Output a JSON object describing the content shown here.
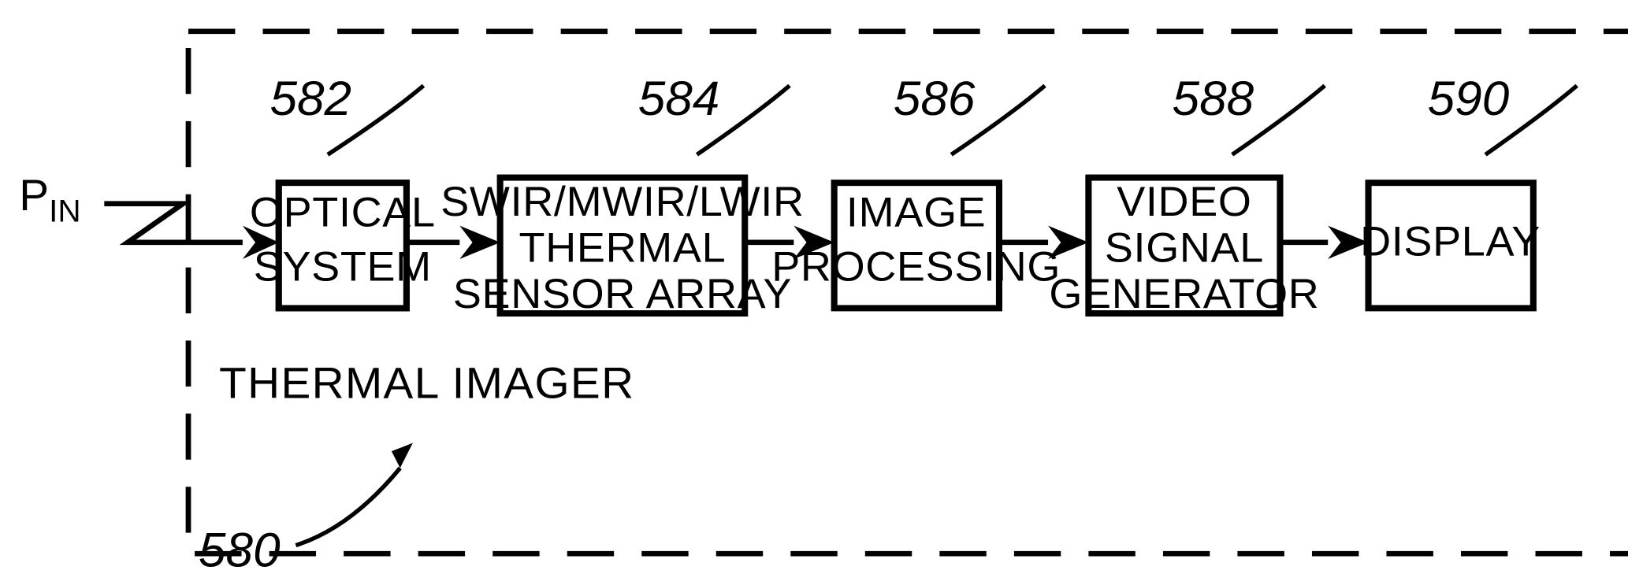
{
  "figure": {
    "title": "THERMAL IMAGER block diagram",
    "stroke_color": "#000000",
    "background_color": "#ffffff"
  },
  "input_signal": {
    "label_main": "P",
    "label_sub": "IN",
    "icon": "zigzag-arrow-icon"
  },
  "enclosure": {
    "label": "THERMAL  IMAGER",
    "reference": "580",
    "style": "dashed"
  },
  "blocks": [
    {
      "id": "optical-system",
      "reference": "582",
      "lines": [
        "OPTICAL",
        "SYSTEM"
      ]
    },
    {
      "id": "thermal-sensor-array",
      "reference": "584",
      "lines": [
        "SWIR/MWIR/LWIR",
        "THERMAL",
        "SENSOR  ARRAY"
      ]
    },
    {
      "id": "image-processing",
      "reference": "586",
      "lines": [
        "IMAGE",
        "PROCESSING"
      ]
    },
    {
      "id": "video-signal-generator",
      "reference": "588",
      "lines": [
        "VIDEO",
        "SIGNAL",
        "GENERATOR"
      ]
    },
    {
      "id": "display",
      "reference": "590",
      "lines": [
        "DISPLAY"
      ]
    }
  ],
  "connectors": [
    {
      "id": "input-to-optical",
      "icon": "arrow-right-icon"
    },
    {
      "id": "optical-to-sensor",
      "icon": "arrow-right-icon"
    },
    {
      "id": "sensor-to-processing",
      "icon": "arrow-right-icon"
    },
    {
      "id": "processing-to-videogen",
      "icon": "arrow-right-icon"
    },
    {
      "id": "videogen-to-display",
      "icon": "arrow-right-icon"
    },
    {
      "id": "enclosure-callout",
      "icon": "curved-arrow-icon"
    }
  ]
}
